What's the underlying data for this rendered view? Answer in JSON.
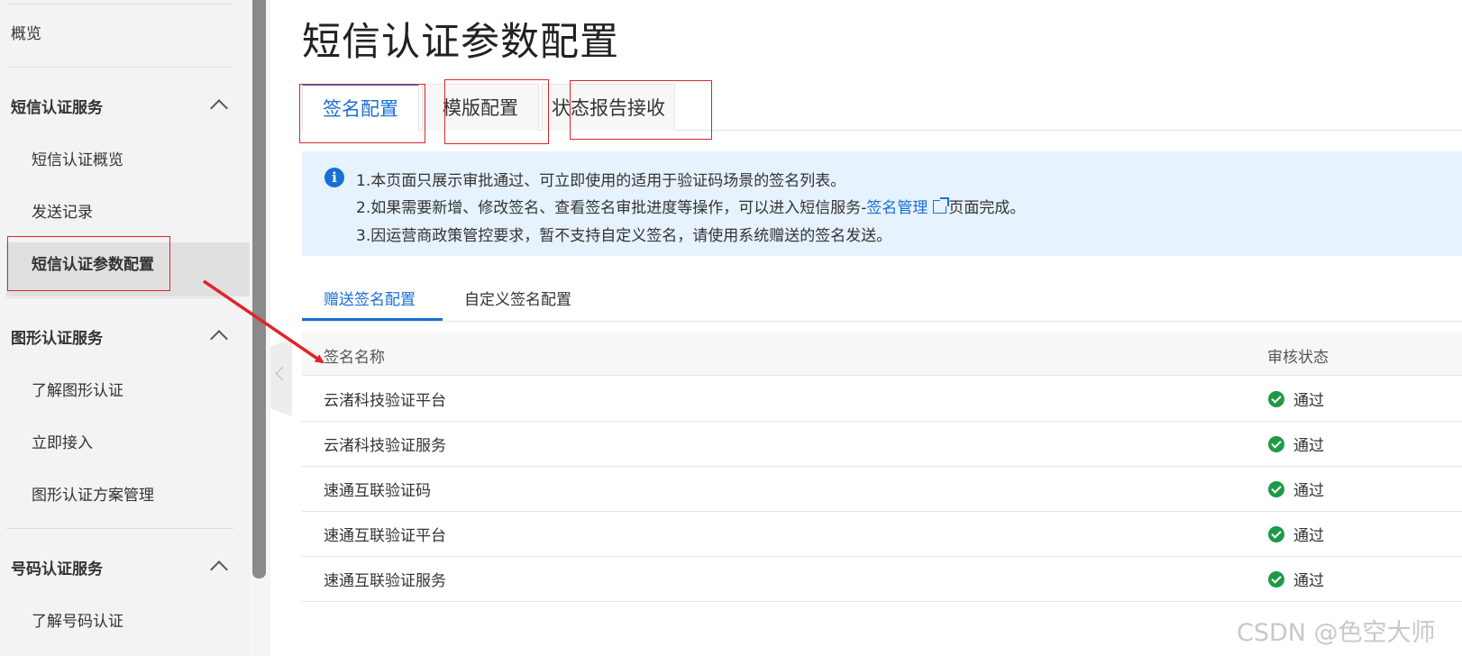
{
  "sidebar": {
    "overview": "概览",
    "sections": [
      {
        "title": "短信认证服务",
        "items": [
          "短信认证概览",
          "发送记录",
          "短信认证参数配置"
        ]
      },
      {
        "title": "图形认证服务",
        "items": [
          "了解图形认证",
          "立即接入",
          "图形认证方案管理"
        ]
      },
      {
        "title": "号码认证服务",
        "items": [
          "了解号码认证"
        ]
      }
    ]
  },
  "main": {
    "title": "短信认证参数配置",
    "tabs": [
      {
        "label": "签名配置",
        "active": true
      },
      {
        "label": "模版配置",
        "active": false
      },
      {
        "label": "状态报告接收",
        "active": false
      }
    ],
    "info": {
      "line1": "1.本页面只展示审批通过、可立即使用的适用于验证码场景的签名列表。",
      "line2_prefix": "2.如果需要新增、修改签名、查看签名审批进度等操作，可以进入短信服务-",
      "line2_link": "签名管理",
      "line2_suffix": "页面完成。",
      "line3": "3.因运营商政策管控要求，暂不支持自定义签名，请使用系统赠送的签名发送。"
    },
    "subtabs": [
      {
        "label": "赠送签名配置",
        "active": true
      },
      {
        "label": "自定义签名配置",
        "active": false
      }
    ],
    "table": {
      "columns": [
        "签名名称",
        "审核状态"
      ],
      "rows": [
        {
          "name": "云渚科技验证平台",
          "status": "通过"
        },
        {
          "name": "云渚科技验证服务",
          "status": "通过"
        },
        {
          "name": "速通互联验证码",
          "status": "通过"
        },
        {
          "name": "速通互联验证平台",
          "status": "通过"
        },
        {
          "name": "速通互联验证服务",
          "status": "通过"
        }
      ]
    }
  },
  "watermark": "CSDN @色空大师",
  "colors": {
    "accent": "#1a6fd2",
    "annotation": "#e0232b",
    "success": "#1e9a47",
    "info_bg": "#e6f2fd"
  }
}
